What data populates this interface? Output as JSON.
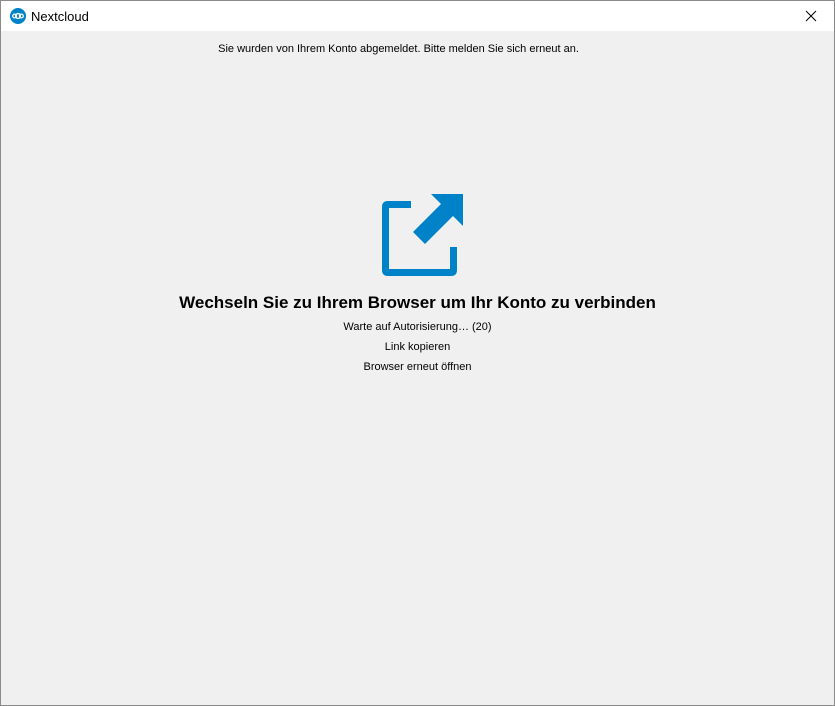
{
  "window": {
    "title": "Nextcloud",
    "close_label": "Close"
  },
  "colors": {
    "brand": "#0082c9",
    "background": "#f0f0f0",
    "titlebar": "#ffffff"
  },
  "message": {
    "logged_out": "Sie wurden von Ihrem Konto abgemeldet. Bitte melden Sie sich erneut an."
  },
  "auth": {
    "icon": "open-in-browser-icon",
    "headline": "Wechseln Sie zu Ihrem Browser um Ihr Konto zu verbinden",
    "status": "Warte auf Autorisierung… (20)",
    "copy_link_label": "Link kopieren",
    "reopen_browser_label": "Browser erneut öffnen"
  }
}
